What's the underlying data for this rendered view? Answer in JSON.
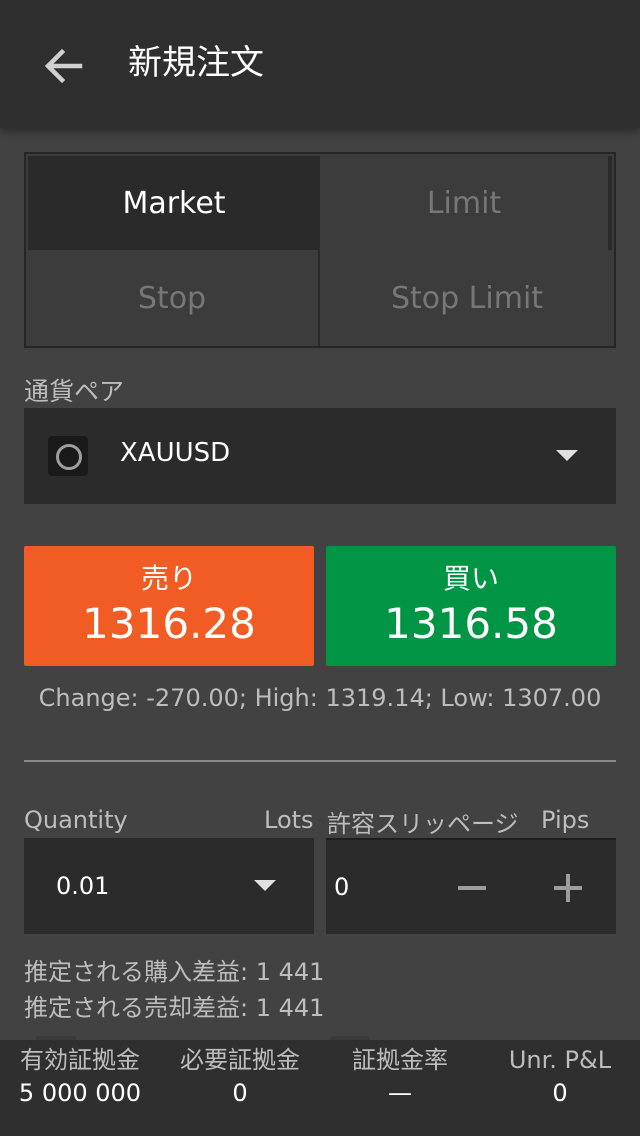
{
  "header": {
    "title": "新規注文",
    "back_icon": "arrow-left-icon"
  },
  "order_types": [
    {
      "label": "Market",
      "active": true
    },
    {
      "label": "Limit",
      "active": false
    },
    {
      "label": "Stop",
      "active": false
    },
    {
      "label": "Stop Limit",
      "active": false
    }
  ],
  "pair": {
    "label": "通貨ペア",
    "value": "XAUUSD",
    "icon": "circle-icon"
  },
  "sell": {
    "label": "売り",
    "price": "1316.28",
    "color": "#f15b24"
  },
  "buy": {
    "label": "買い",
    "price": "1316.58",
    "color": "#009544"
  },
  "stats": "Change: -270.00; High: 1319.14; Low: 1307.00",
  "quantity": {
    "label": "Quantity",
    "unit": "Lots",
    "value": "0.01"
  },
  "slippage": {
    "label": "許容スリッページ",
    "unit": "Pips",
    "value": "0"
  },
  "estimates": {
    "buy": "推定される購入差益: 1 441",
    "sell": "推定される売却差益: 1 441"
  },
  "footer": [
    {
      "label": "有効証拠金",
      "value": "5 000 000"
    },
    {
      "label": "必要証拠金",
      "value": "0"
    },
    {
      "label": "証拠金率",
      "value": "—"
    },
    {
      "label": "Unr. P&L",
      "value": "0"
    }
  ]
}
